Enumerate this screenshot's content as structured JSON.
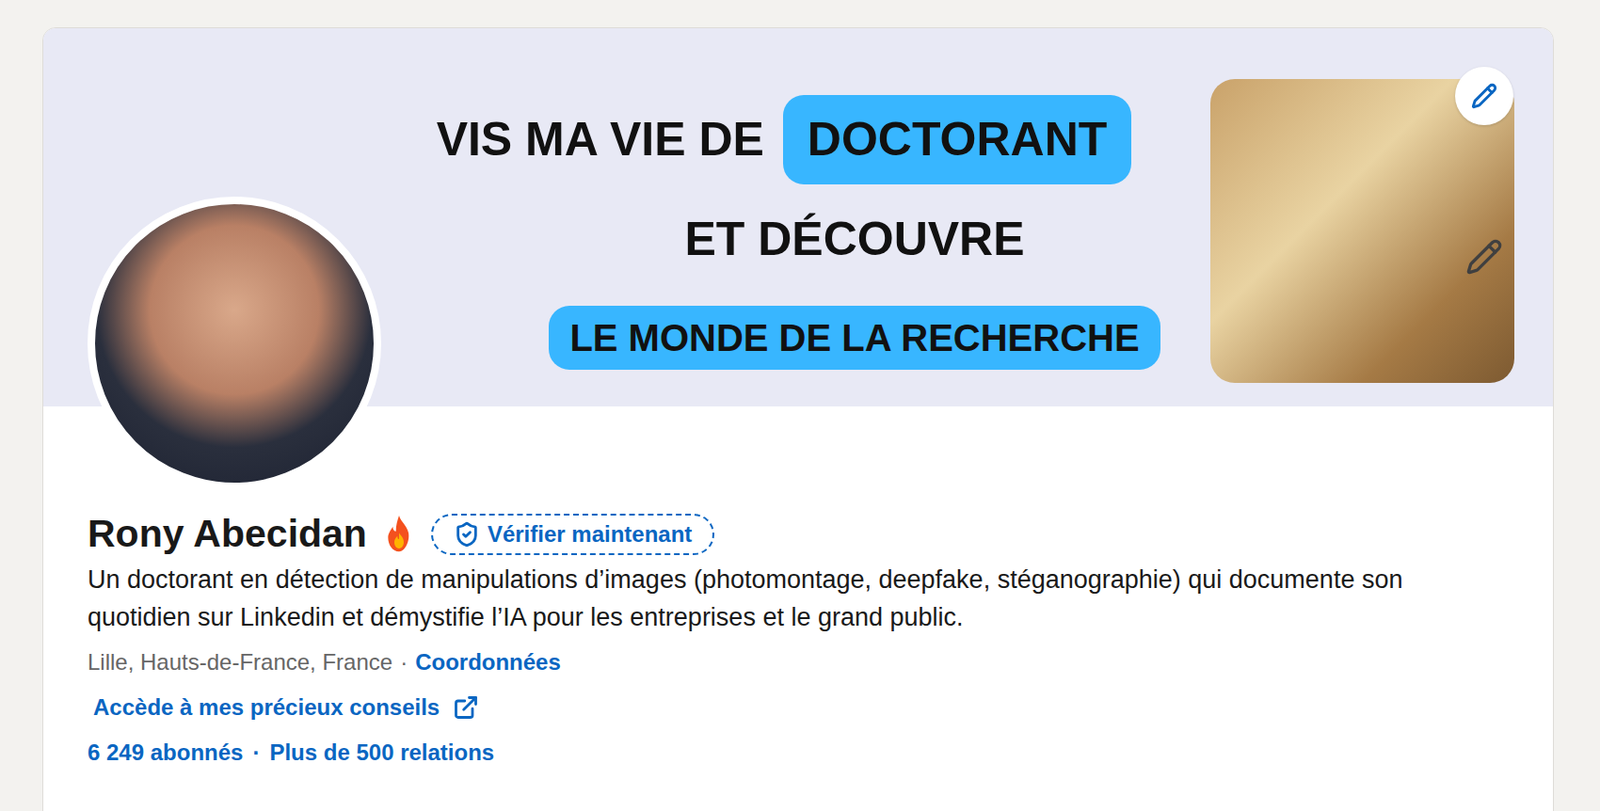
{
  "banner": {
    "rows": [
      {
        "parts": [
          {
            "text": "VIS MA VIE DE",
            "highlighted": false
          },
          {
            "text": "DOCTORANT",
            "highlighted": true
          }
        ]
      },
      {
        "parts": [
          {
            "text": "ET DÉCOUVRE",
            "highlighted": false
          }
        ]
      },
      {
        "parts": [
          {
            "text": "LE MONDE DE LA RECHERCHE",
            "highlighted": true
          }
        ]
      }
    ]
  },
  "profile": {
    "name": "Rony Abecidan",
    "verify_button": "Vérifier maintenant",
    "headline": "Un doctorant en détection de manipulations d’images (photomontage, deepfake, stéganographie) qui documente son quotidien sur Linkedin et démystifie l’IA pour les entreprises et le grand public.",
    "location": "Lille, Hauts-de-France, France",
    "separator": "·",
    "contact_link": "Coordonnées",
    "website_link": "Accède à mes précieux conseils",
    "followers": "6 249 abonnés",
    "connections": "Plus de 500 relations"
  }
}
